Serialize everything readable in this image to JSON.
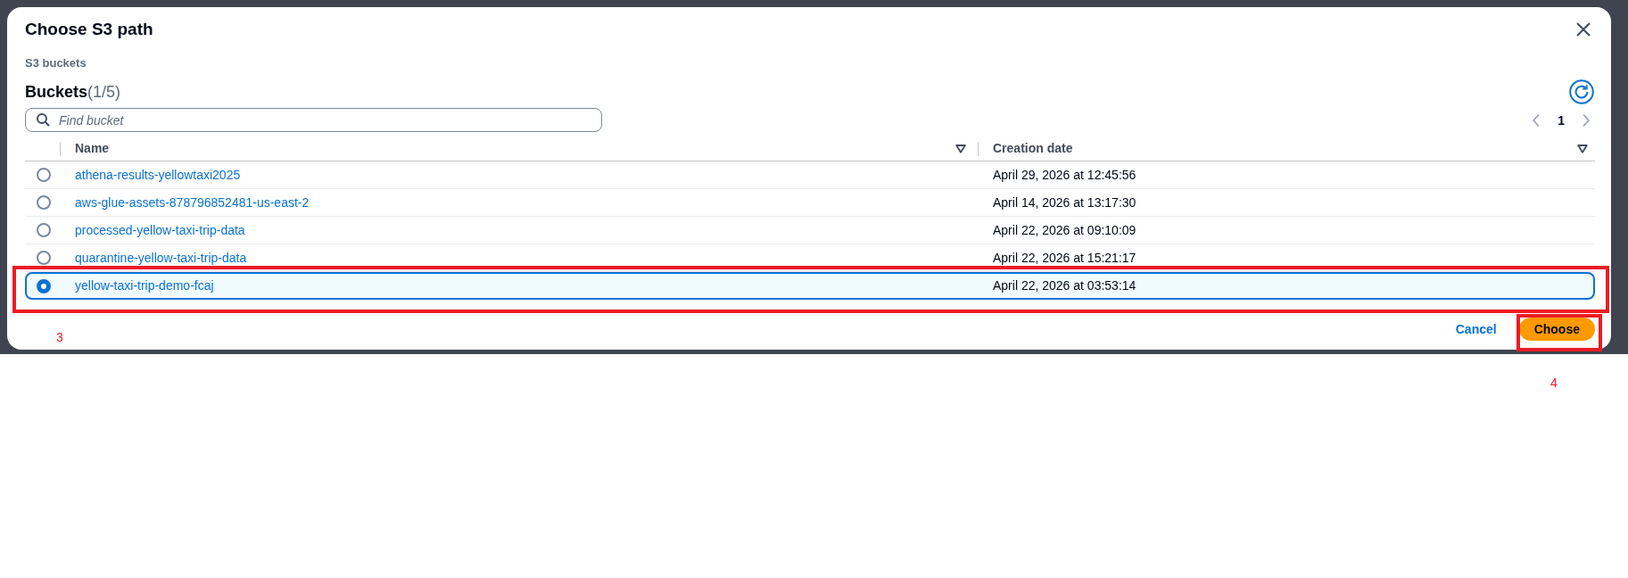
{
  "dialog": {
    "title": "Choose S3 path",
    "section_label": "S3 buckets"
  },
  "table": {
    "title": "Buckets",
    "count": "(1/5)",
    "search": {
      "placeholder": "Find bucket"
    },
    "pagination": {
      "prev_disabled": true,
      "pages": [
        {
          "label": "1",
          "selected": true
        }
      ],
      "next_disabled": true
    },
    "columns": [
      {
        "label": "Name",
        "sortable": true
      },
      {
        "label": "Creation date",
        "sortable": true
      }
    ],
    "rows": [
      {
        "name": "athena-results-yellowtaxi2025",
        "created": "April 29, 2026 at 12:45:56",
        "selected": false
      },
      {
        "name": "aws-glue-assets-878796852481-us-east-2",
        "created": "April 14, 2026 at 13:17:30",
        "selected": false
      },
      {
        "name": "processed-yellow-taxi-trip-data",
        "created": "April 22, 2026 at 09:10:09",
        "selected": false
      },
      {
        "name": "quarantine-yellow-taxi-trip-data",
        "created": "April 22, 2026 at 15:21:17",
        "selected": false
      },
      {
        "name": "yellow-taxi-trip-demo-fcaj",
        "created": "April 22, 2026 at 03:53:14",
        "selected": true
      }
    ]
  },
  "footer": {
    "cancel": "Cancel",
    "confirm": "Choose"
  },
  "annotations": [
    {
      "label": "3"
    },
    {
      "label": "4"
    }
  ]
}
